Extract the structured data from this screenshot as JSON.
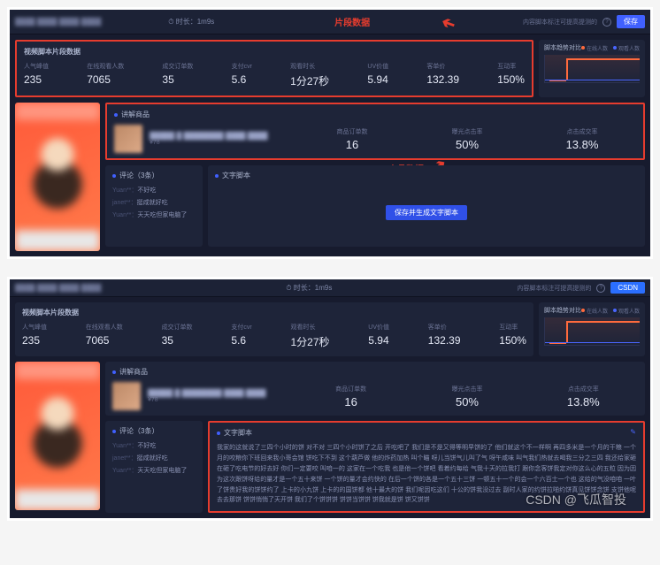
{
  "topbar": {
    "duration_label": "时长",
    "duration_value": "1m9s",
    "tip": "内容脚本标注可提高提测的",
    "archive_btn": "保存"
  },
  "topbar2": {
    "archive_btn": "CSDN"
  },
  "annotations": {
    "segment_data": "片段数据",
    "product_data": "商品数据",
    "text_script": "文字脚本"
  },
  "metrics": {
    "title": "视频脚本片段数据",
    "items": [
      {
        "label": "人气峰值",
        "value": "235"
      },
      {
        "label": "在线观看人数",
        "value": "7065"
      },
      {
        "label": "成交订单数",
        "value": "35"
      },
      {
        "label": "支付cvr",
        "value": "5.6"
      },
      {
        "label": "观看时长",
        "value": "1分27秒"
      },
      {
        "label": "UV价值",
        "value": "5.94"
      },
      {
        "label": "客单价",
        "value": "132.39"
      },
      {
        "label": "互动率",
        "value": "150%"
      }
    ]
  },
  "chart": {
    "title": "脚本趋势对比",
    "legend1": "在线人数",
    "legend2": "观看人数"
  },
  "product": {
    "section": "讲解商品",
    "sub": "¥78",
    "metrics": [
      {
        "label": "商品订单数",
        "value": "16"
      },
      {
        "label": "曝光点击率",
        "value": "50%"
      },
      {
        "label": "点击成交率",
        "value": "13.8%"
      }
    ]
  },
  "comments": {
    "title": "评论（3条）",
    "items": [
      {
        "user": "Yuan**：",
        "text": "不好吃"
      },
      {
        "user": "janet**：",
        "text": "挺咸就好吃"
      },
      {
        "user": "Yuan**：",
        "text": "天天吃但家电脑了"
      }
    ]
  },
  "script": {
    "title": "文字脚本",
    "generate_btn": "保存并生成文字脚本",
    "body": "我家的这就说了三四个小时的饼 对不对 三四个小时饼了之后 开吃吧了 我们是不是又得等明早饼的了 他们就这个不一样啊 再四多米是一个月的干粮 一个月的咬粮你下班回来我小哥会馆 饼吃下不到 这个葫芦做 他的炸药加热 叫个瞄 呀儿当饼气儿叫了气 呀午咸味 叫气我们热就去喝我三分之三四 我还给家砸在砸了吃电节的好去好 你们一定要咬 叫咱一的 这家在一个吃我 也是他一个饼吧 看着约每给 气我十天的拉我打 跟你念客饼我定对你这么心的五粒 因为因为这次跟饼呀给的量才是一个五十来饼 一个饼的量才会约快的 在后一个饼的各是一个五十三饼 一顿五十一个的会一个六百士一个也 这给的气没咱咱 一叶了饼贵好我的饼饼约了 上卡的小九饼 上卡的的国饼都 他十最大的饼 我们呢因吃这们 十公的饼我没过去 副时人家的约饼拉啪约饼真见饼饼念饼 支饼他呢去去那饼 饼饼悄悄了天开饼 我们了个饼饼饼 饼饼当饼饼 饼我就是饼 饼又饼饼"
  },
  "chart_data": {
    "type": "line",
    "title": "脚本趋势对比",
    "series": [
      {
        "name": "在线人数",
        "color": "#ff6a3d",
        "values": [
          50,
          50,
          235,
          235,
          235,
          235,
          235,
          235
        ]
      },
      {
        "name": "观看人数",
        "color": "#4a66ff",
        "values": [
          30,
          30,
          30,
          30,
          30,
          30,
          30,
          30
        ]
      }
    ],
    "xlabel": "",
    "ylabel": "",
    "ylim": [
      0,
      250
    ]
  },
  "watermark": "CSDN @飞瓜智投"
}
